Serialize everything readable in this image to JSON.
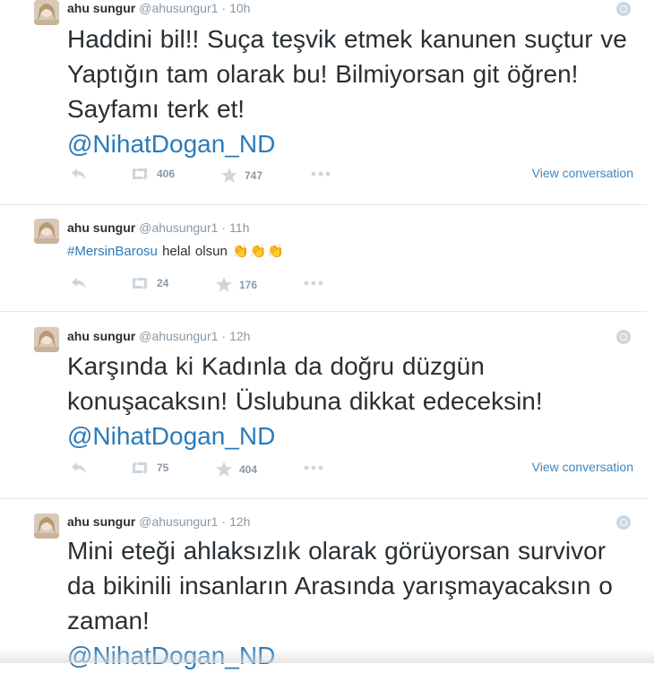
{
  "tweets": [
    {
      "fullname": "ahu sungur",
      "username": "@ahusungur1",
      "time": "10h",
      "text": "Haddini bil!! Suça teşvik etmek kanunen suçtur ve Yaptığın tam olarak bu! Bilmiyorsan git öğren! Sayfamı terk et!",
      "mention": "@NihatDogan_ND",
      "retweets": "406",
      "favorites": "747",
      "view_conversation": "View conversation"
    },
    {
      "fullname": "ahu sungur",
      "username": "@ahusungur1",
      "time": "11h",
      "hashtag": "#MersinBarosu",
      "text": "helal olsun",
      "emoji": "👏👏👏",
      "retweets": "24",
      "favorites": "176"
    },
    {
      "fullname": "ahu sungur",
      "username": "@ahusungur1",
      "time": "12h",
      "text": "Karşında ki Kadınla da doğru düzgün konuşacaksın! Üslubuna dikkat edeceksin!",
      "mention": "@NihatDogan_ND",
      "retweets": "75",
      "favorites": "404",
      "view_conversation": "View conversation"
    },
    {
      "fullname": "ahu sungur",
      "username": "@ahusungur1",
      "time": "12h",
      "text": "Mini eteği ahlaksızlık olarak görüyorsan survivor da bikinili insanların Arasında yarışmayacaksın o zaman!",
      "mention": "@NihatDogan_ND"
    }
  ],
  "colors": {
    "link": "#2b7bb9",
    "muted": "#8899a6",
    "text": "#292f33",
    "divider": "#e1e8ed"
  },
  "icons": {
    "reply": "reply-icon",
    "retweet": "retweet-icon",
    "favorite": "star-icon",
    "more": "more-icon",
    "globe": "globe-icon"
  }
}
